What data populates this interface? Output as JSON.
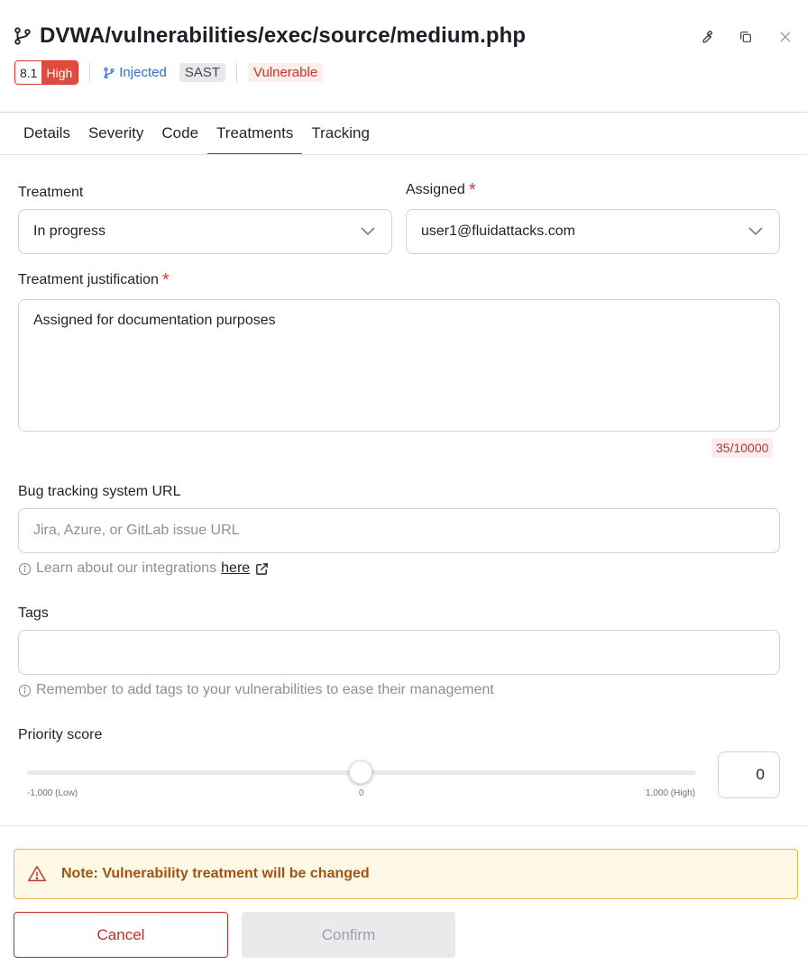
{
  "header": {
    "title": "DVWA/vulnerabilities/exec/source/medium.php",
    "title_icon": "git-branch-icon",
    "actions": [
      "wrench-icon",
      "copy-icon",
      "close-icon"
    ],
    "score": "8.1",
    "severity": "High",
    "technique_label": "Injected",
    "scan_type": "SAST",
    "state": "Vulnerable"
  },
  "tabs": [
    {
      "label": "Details"
    },
    {
      "label": "Severity"
    },
    {
      "label": "Code"
    },
    {
      "label": "Treatments",
      "active": true
    },
    {
      "label": "Tracking"
    }
  ],
  "form": {
    "treatment": {
      "label": "Treatment",
      "value": "In progress"
    },
    "assigned": {
      "label": "Assigned",
      "required_mark": "*",
      "value": "user1@fluidattacks.com"
    },
    "justification": {
      "label": "Treatment justification",
      "required_mark": "*",
      "value": "Assigned for documentation purposes",
      "counter": "35/10000"
    },
    "bug_tracking": {
      "label": "Bug tracking system URL",
      "placeholder": "Jira, Azure, or GitLab issue URL",
      "hint": "Learn about our integrations",
      "hint_link": "here"
    },
    "tags": {
      "label": "Tags",
      "value": "",
      "hint": "Remember to add tags to your vulnerabilities to ease their management"
    },
    "priority": {
      "label": "Priority score",
      "min_label": "-1,000 (Low)",
      "mid_label": "0",
      "max_label": "1,000 (High)",
      "min": -1000,
      "max": 1000,
      "value": "0"
    }
  },
  "alert": {
    "message": "Note: Vulnerability treatment will be changed"
  },
  "buttons": {
    "cancel": "Cancel",
    "confirm": "Confirm"
  },
  "colors": {
    "accent": "#bd2e2a",
    "severity_high": "#dd4c3e",
    "warning_bg": "#fef9e7",
    "warning_border": "#f0b24a",
    "link_blue": "#2f6fd6"
  }
}
